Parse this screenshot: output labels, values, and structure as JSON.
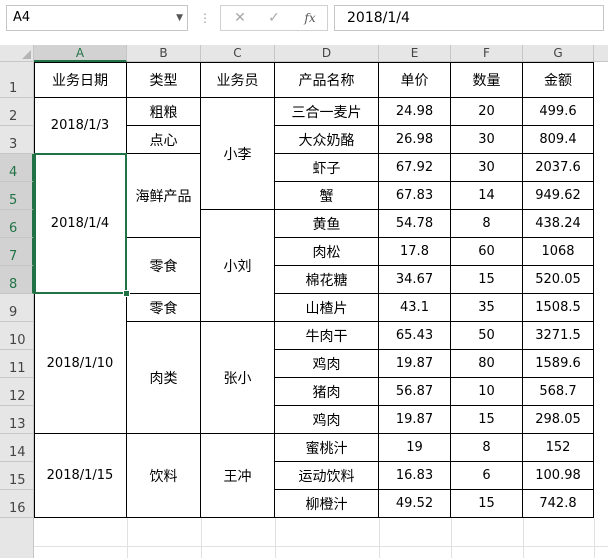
{
  "formula_bar": {
    "name_box": "A4",
    "name_box_dropdown_icon": "chevron-down-icon",
    "cancel_glyph": "✕",
    "confirm_glyph": "✓",
    "fx_label": "fx",
    "formula_value": "2018/1/4"
  },
  "sheet": {
    "selected_cell": "A4",
    "accent_color": "#217346",
    "column_headers": [
      "A",
      "B",
      "C",
      "D",
      "E",
      "F",
      "G"
    ],
    "row_headers": [
      "1",
      "2",
      "3",
      "4",
      "5",
      "6",
      "7",
      "8",
      "9",
      "10",
      "11",
      "12",
      "13",
      "14",
      "15",
      "16"
    ],
    "header_row": [
      "业务日期",
      "类型",
      "业务员",
      "产品名称",
      "单价",
      "数量",
      "金额"
    ],
    "dates": [
      "2018/1/3",
      "2018/1/4",
      "2018/1/10",
      "2018/1/15"
    ],
    "types": [
      "粗粮",
      "点心",
      "海鲜产品",
      "零食",
      "零食",
      "肉类",
      "饮料"
    ],
    "salespeople": [
      "小李",
      "小刘",
      "张小",
      "王冲"
    ],
    "rows": [
      {
        "product": "三合一麦片",
        "price": "24.98",
        "qty": "20",
        "amount": "499.6"
      },
      {
        "product": "大众奶酪",
        "price": "26.98",
        "qty": "30",
        "amount": "809.4"
      },
      {
        "product": "虾子",
        "price": "67.92",
        "qty": "30",
        "amount": "2037.6"
      },
      {
        "product": "蟹",
        "price": "67.83",
        "qty": "14",
        "amount": "949.62"
      },
      {
        "product": "黄鱼",
        "price": "54.78",
        "qty": "8",
        "amount": "438.24"
      },
      {
        "product": "肉松",
        "price": "17.8",
        "qty": "60",
        "amount": "1068"
      },
      {
        "product": "棉花糖",
        "price": "34.67",
        "qty": "15",
        "amount": "520.05"
      },
      {
        "product": "山楂片",
        "price": "43.1",
        "qty": "35",
        "amount": "1508.5"
      },
      {
        "product": "牛肉干",
        "price": "65.43",
        "qty": "50",
        "amount": "3271.5"
      },
      {
        "product": "鸡肉",
        "price": "19.87",
        "qty": "80",
        "amount": "1589.6"
      },
      {
        "product": "猪肉",
        "price": "56.87",
        "qty": "10",
        "amount": "568.7"
      },
      {
        "product": "鸡肉",
        "price": "19.87",
        "qty": "15",
        "amount": "298.05"
      },
      {
        "product": "蜜桃汁",
        "price": "19",
        "qty": "8",
        "amount": "152"
      },
      {
        "product": "运动饮料",
        "price": "16.83",
        "qty": "6",
        "amount": "100.98"
      },
      {
        "product": "柳橙汁",
        "price": "49.52",
        "qty": "15",
        "amount": "742.8"
      }
    ]
  }
}
